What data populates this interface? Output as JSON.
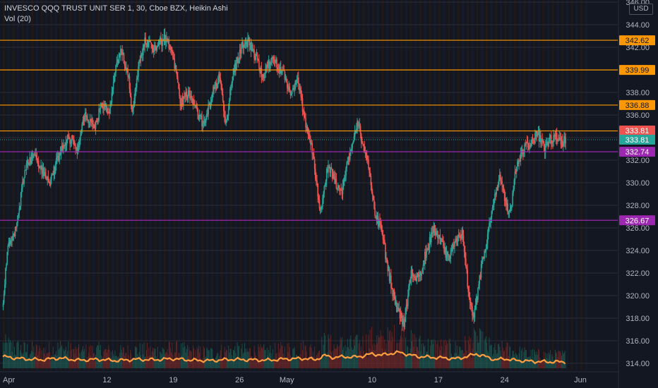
{
  "header": {
    "title": "INVESCO QQQ TRUST UNIT SER 1, 30, Cboe BZX, Heikin Ashi",
    "volume_label": "Vol (20)",
    "currency": "USD"
  },
  "colors": {
    "background": "#131722",
    "up": "#26a69a",
    "down": "#ef5350",
    "resistance": "#ff9800",
    "support": "#9c27b0",
    "volume_ma": "#ff9e40",
    "last_price": "#26a69a",
    "prev_close": "#ef5350"
  },
  "chart_data": {
    "type": "candlestick",
    "style": "Heikin Ashi",
    "interval": "30",
    "ylim": [
      313.0,
      346.0
    ],
    "y_ticks": [
      "314.00",
      "316.00",
      "318.00",
      "320.00",
      "322.00",
      "324.00",
      "326.00",
      "328.00",
      "330.00",
      "332.00",
      "334.00",
      "336.00",
      "338.00",
      "340.00",
      "342.00",
      "344.00",
      "346.00"
    ],
    "x_ticks": [
      {
        "label": "Apr",
        "day": 0
      },
      {
        "label": "12",
        "day": 11
      },
      {
        "label": "19",
        "day": 18
      },
      {
        "label": "26",
        "day": 25
      },
      {
        "label": "May",
        "day": 30
      },
      {
        "label": "10",
        "day": 39
      },
      {
        "label": "17",
        "day": 46
      },
      {
        "label": "24",
        "day": 53
      },
      {
        "label": "Jun",
        "day": 61
      }
    ],
    "x_range_days": [
      0,
      63
    ],
    "horizontal_levels": [
      {
        "price": 342.62,
        "label": "342.62",
        "kind": "resistance"
      },
      {
        "price": 339.99,
        "label": "339.99",
        "kind": "resistance"
      },
      {
        "price": 336.88,
        "label": "336.88",
        "kind": "resistance"
      },
      {
        "price": 334.59,
        "label": "334.59",
        "kind": "resistance"
      },
      {
        "price": 332.74,
        "label": "332.74",
        "kind": "support"
      },
      {
        "price": 326.67,
        "label": "326.67",
        "kind": "support"
      }
    ],
    "price_tags": [
      {
        "price": 333.81,
        "label": "333.81",
        "kind": "prev_close"
      },
      {
        "price": 333.81,
        "label": "333.81",
        "kind": "last_price"
      }
    ],
    "price_path": [
      [
        0,
        319.0
      ],
      [
        0.6,
        324.5
      ],
      [
        1.5,
        326.0
      ],
      [
        2.4,
        331.5
      ],
      [
        3.4,
        332.5
      ],
      [
        4.2,
        331.0
      ],
      [
        5.0,
        330.0
      ],
      [
        6.0,
        332.5
      ],
      [
        7.0,
        334.0
      ],
      [
        8.0,
        333.0
      ],
      [
        8.7,
        336.0
      ],
      [
        9.8,
        335.0
      ],
      [
        10.5,
        337.0
      ],
      [
        11.3,
        336.0
      ],
      [
        11.8,
        339.5
      ],
      [
        12.6,
        341.8
      ],
      [
        13.4,
        339.0
      ],
      [
        13.7,
        336.0
      ],
      [
        14.2,
        339.5
      ],
      [
        15.0,
        342.5
      ],
      [
        16.0,
        342.0
      ],
      [
        17.2,
        342.8
      ],
      [
        18.0,
        341.5
      ],
      [
        18.8,
        337.0
      ],
      [
        19.6,
        338.0
      ],
      [
        20.4,
        336.5
      ],
      [
        21.3,
        335.0
      ],
      [
        22.2,
        338.0
      ],
      [
        23.0,
        339.5
      ],
      [
        23.6,
        335.0
      ],
      [
        24.3,
        339.5
      ],
      [
        25.2,
        342.0
      ],
      [
        26.0,
        342.5
      ],
      [
        26.8,
        341.0
      ],
      [
        27.5,
        339.5
      ],
      [
        28.6,
        341.0
      ],
      [
        29.5,
        340.0
      ],
      [
        30.4,
        338.0
      ],
      [
        31.3,
        339.0
      ],
      [
        31.8,
        336.0
      ],
      [
        32.6,
        333.5
      ],
      [
        33.6,
        327.5
      ],
      [
        34.4,
        331.5
      ],
      [
        35.2,
        330.0
      ],
      [
        35.8,
        329.0
      ],
      [
        36.5,
        332.0
      ],
      [
        37.2,
        334.5
      ],
      [
        37.6,
        335.5
      ],
      [
        38.1,
        333.0
      ],
      [
        38.8,
        331.0
      ],
      [
        39.4,
        327.0
      ],
      [
        40.0,
        326.0
      ],
      [
        40.8,
        322.0
      ],
      [
        41.6,
        319.0
      ],
      [
        42.4,
        317.5
      ],
      [
        43.2,
        322.0
      ],
      [
        44.0,
        321.5
      ],
      [
        44.8,
        324.0
      ],
      [
        45.6,
        326.0
      ],
      [
        46.4,
        324.5
      ],
      [
        47.2,
        323.0
      ],
      [
        47.8,
        325.0
      ],
      [
        48.6,
        325.5
      ],
      [
        49.4,
        319.0
      ],
      [
        49.8,
        318.0
      ],
      [
        50.6,
        322.5
      ],
      [
        51.2,
        325.0
      ],
      [
        51.8,
        328.0
      ],
      [
        52.6,
        330.5
      ],
      [
        53.2,
        328.0
      ],
      [
        53.6,
        327.0
      ],
      [
        54.2,
        331.0
      ],
      [
        55.0,
        333.0
      ],
      [
        55.8,
        333.5
      ],
      [
        56.5,
        334.3
      ],
      [
        57.3,
        333.0
      ],
      [
        57.9,
        333.8
      ],
      [
        58.5,
        334.0
      ],
      [
        59.0,
        333.5
      ],
      [
        59.5,
        333.81
      ]
    ],
    "volume_ma_path": [
      [
        0,
        0.55
      ],
      [
        2,
        0.45
      ],
      [
        4,
        0.4
      ],
      [
        6,
        0.48
      ],
      [
        8,
        0.38
      ],
      [
        10,
        0.42
      ],
      [
        12,
        0.36
      ],
      [
        14,
        0.42
      ],
      [
        16,
        0.4
      ],
      [
        18,
        0.45
      ],
      [
        20,
        0.38
      ],
      [
        22,
        0.36
      ],
      [
        24,
        0.42
      ],
      [
        26,
        0.4
      ],
      [
        28,
        0.38
      ],
      [
        30,
        0.44
      ],
      [
        32,
        0.46
      ],
      [
        33,
        0.4
      ],
      [
        34,
        0.6
      ],
      [
        35,
        0.5
      ],
      [
        36,
        0.55
      ],
      [
        37,
        0.52
      ],
      [
        38,
        0.58
      ],
      [
        39,
        0.68
      ],
      [
        40,
        0.62
      ],
      [
        41,
        0.7
      ],
      [
        42,
        0.75
      ],
      [
        43,
        0.62
      ],
      [
        44,
        0.55
      ],
      [
        46,
        0.5
      ],
      [
        48,
        0.45
      ],
      [
        49,
        0.55
      ],
      [
        50,
        0.68
      ],
      [
        51,
        0.55
      ],
      [
        52,
        0.4
      ],
      [
        53,
        0.45
      ],
      [
        54,
        0.38
      ],
      [
        56,
        0.32
      ],
      [
        58,
        0.3
      ],
      [
        59.5,
        0.3
      ]
    ]
  }
}
